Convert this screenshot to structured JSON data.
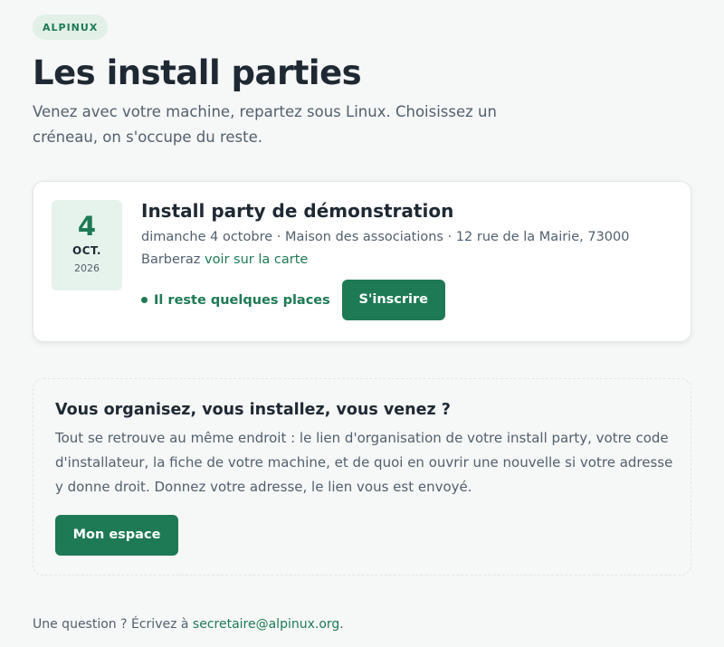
{
  "header": {
    "badge": "ALPINUX",
    "title": "Les install parties",
    "intro": "Venez avec votre machine, repartez sous Linux. Choisissez un créneau, on s'occupe du reste."
  },
  "event": {
    "date_day": "4",
    "date_month": "OCT.",
    "date_year": "2026",
    "title": "Install party de démonstration",
    "details": "dimanche 4 octobre · Maison des associations · 12 rue de la Mairie, 73000 Barberaz",
    "map_link": "voir sur la carte",
    "availability": "Il reste quelques places",
    "register_label": "S'inscrire"
  },
  "panel": {
    "title": "Vous organisez, vous installez, vous venez ?",
    "text": "Tout se retrouve au même endroit : le lien d'organisation de votre install party, votre code d'installateur, la fiche de votre machine, et de quoi en ouvrir une nouvelle si votre adresse y donne droit. Donnez votre adresse, le lien vous est envoyé.",
    "button_label": "Mon espace"
  },
  "footer": {
    "prefix": "Une question ? Écrivez à",
    "email": "secretaire@alpinux.org",
    "suffix": "."
  },
  "colors": {
    "accent": "#1d7a55",
    "badge_bg": "#e2f0e8",
    "date_bg": "#e6f2ec",
    "page_bg": "#f6f7f7"
  }
}
